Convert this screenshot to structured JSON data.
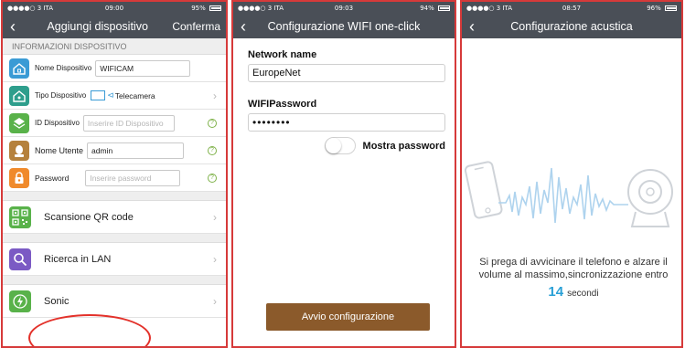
{
  "screen1": {
    "status": {
      "left": "●●●●○ 3 ITA",
      "time": "09:00",
      "battery": "95%",
      "battery_level": 0.95
    },
    "nav": {
      "title": "Aggiungi dispositivo",
      "action": "Conferma"
    },
    "section_title": "INFORMAZIONI DISPOSITIVO",
    "rows": {
      "name": {
        "label": "Nome Dispositivo",
        "value": "WIFICAM",
        "icon": "home-icon",
        "color": "#3a9bd5"
      },
      "type": {
        "label": "Tipo Dispositivo",
        "value": "Telecamera",
        "icon": "home-icon",
        "color": "#2e9e8c"
      },
      "id": {
        "label": "ID Dispositivo",
        "placeholder": "Inserire ID Dispositivo",
        "icon": "layers-icon",
        "color": "#59b24a"
      },
      "user": {
        "label": "Nome Utente",
        "value": "admin",
        "icon": "user-icon",
        "color": "#b5813c"
      },
      "password": {
        "label": "Password",
        "placeholder": "Inserire password",
        "icon": "lock-icon",
        "color": "#f08a2b"
      }
    },
    "actions": {
      "qr": {
        "label": "Scansione QR code",
        "icon": "qr-code-icon",
        "color": "#59b24a"
      },
      "lan": {
        "label": "Ricerca in LAN",
        "icon": "search-icon",
        "color": "#7b5ac4"
      },
      "sonic": {
        "label": "Sonic",
        "icon": "sonic-icon",
        "color": "#59b24a"
      }
    },
    "help_glyph": "?",
    "chevron": "›"
  },
  "screen2": {
    "status": {
      "left": "●●●●○ 3 ITA",
      "time": "09:03",
      "battery": "94%",
      "battery_level": 0.94
    },
    "nav": {
      "title": "Configurazione WIFI one-click"
    },
    "network_label": "Network name",
    "network_value": "EuropeNet",
    "password_label": "WIFIPassword",
    "password_value": "••••••••",
    "show_password_label": "Mostra password",
    "show_password_on": false,
    "start_button": "Avvio configurazione",
    "button_color": "#8b5a2b"
  },
  "screen3": {
    "status": {
      "left": "●●●●○ 3 ITA",
      "time": "08:57",
      "battery": "96%",
      "battery_level": 0.96
    },
    "nav": {
      "title": "Configurazione acustica"
    },
    "instruction_line1": "Si prega di avvicinare il telefono e alzare il",
    "instruction_line2": "volume al massimo,sincronizzazione entro",
    "countdown": "14",
    "countdown_unit": "secondi",
    "accent_color": "#2aa0d6"
  },
  "colors": {
    "nav_bg": "#4a4f57",
    "panel_border": "#d63a3a",
    "highlight": "#e3312a"
  }
}
